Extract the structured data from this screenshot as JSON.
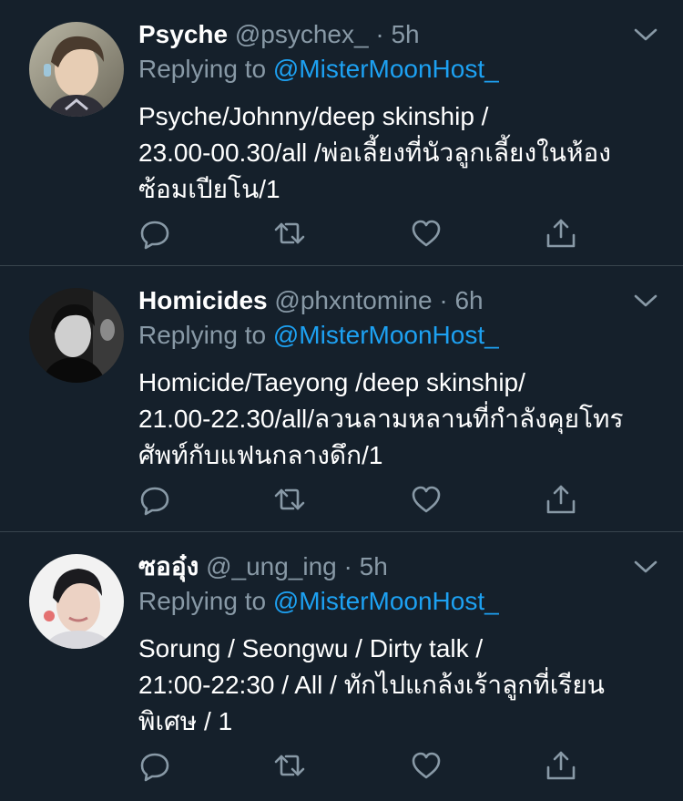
{
  "colors": {
    "background": "#15202b",
    "divider": "#38444d",
    "muted": "#8899a6",
    "link": "#1da1f2",
    "text": "#ffffff"
  },
  "tweets": [
    {
      "display_name": "Psyche",
      "handle": "@psychex_",
      "dot": "·",
      "time": "5h",
      "replying_prefix": "Replying to",
      "replying_handle": "@MisterMoonHost_",
      "lines": [
        "Psyche/Johnny/deep skinship /",
        "23.00-00.30/all /พ่อเลี้ยงที่นัวลูกเลี้ยงในห้อง",
        "ซ้อมเปียโน/1"
      ],
      "icons": [
        "reply-icon",
        "retweet-icon",
        "like-icon",
        "share-icon",
        "chevron-down-icon"
      ]
    },
    {
      "display_name": "Homicides",
      "handle": "@phxntomine",
      "dot": "·",
      "time": "6h",
      "replying_prefix": "Replying to",
      "replying_handle": "@MisterMoonHost_",
      "lines": [
        "Homicide/Taeyong /deep skinship/",
        "21.00-22.30/all/ลวนลามหลานที่กำลังคุยโทร",
        "ศัพท์กับแฟนกลางดึก/1"
      ],
      "icons": [
        "reply-icon",
        "retweet-icon",
        "like-icon",
        "share-icon",
        "chevron-down-icon"
      ]
    },
    {
      "display_name": "ซออุ๋ง",
      "handle": "@_ung_ing",
      "dot": "·",
      "time": "5h",
      "replying_prefix": "Replying to",
      "replying_handle": "@MisterMoonHost_",
      "lines": [
        "Sorung / Seongwu / Dirty talk /",
        "21:00-22:30 / All / ทักไปแกล้งเร้าลูกที่เรียน",
        "พิเศษ / 1"
      ],
      "icons": [
        "reply-icon",
        "retweet-icon",
        "like-icon",
        "share-icon",
        "chevron-down-icon"
      ]
    }
  ]
}
